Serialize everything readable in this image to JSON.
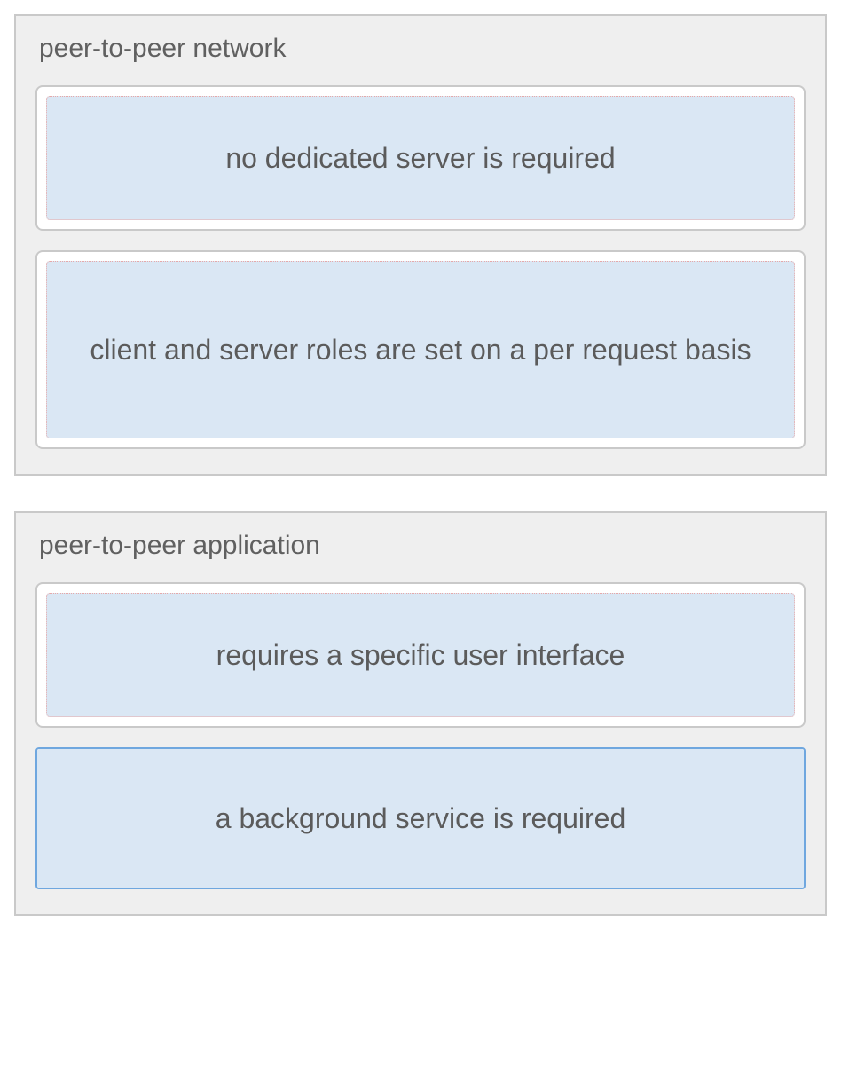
{
  "groups": [
    {
      "title": "peer-to-peer network",
      "cards": [
        {
          "text": "no dedicated server is required",
          "tall": false,
          "selected": false
        },
        {
          "text": "client and server roles are set on a per request basis",
          "tall": true,
          "selected": false
        }
      ]
    },
    {
      "title": "peer-to-peer application",
      "cards": [
        {
          "text": "requires a specific user interface",
          "tall": false,
          "selected": false
        },
        {
          "text": "a background service is required",
          "tall": false,
          "selected": true
        }
      ]
    }
  ]
}
